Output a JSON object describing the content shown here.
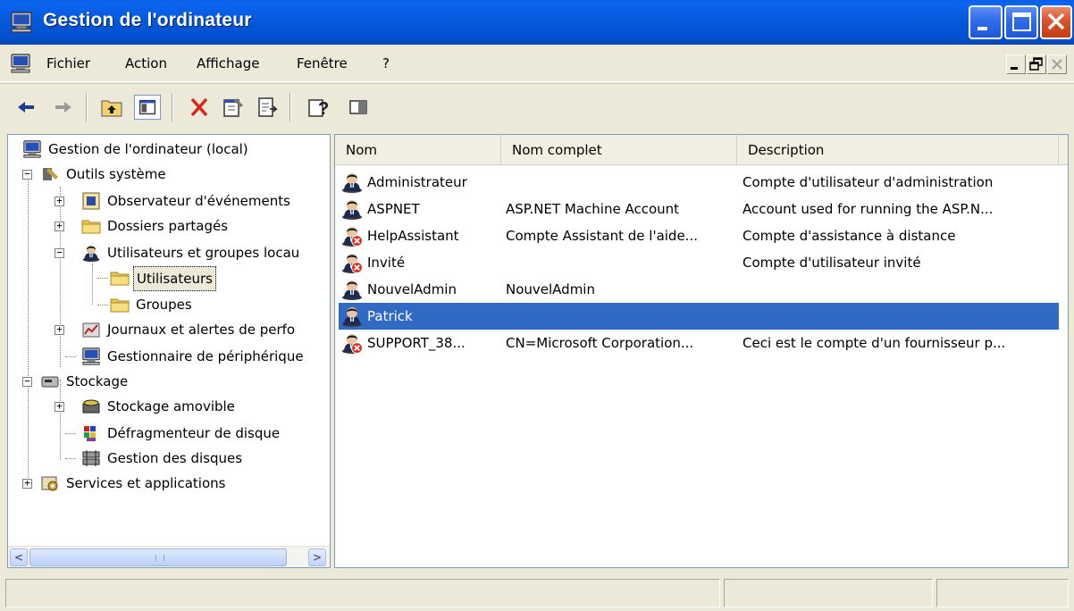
{
  "window": {
    "title": "Gestion de l'ordinateur",
    "title_icon": "computer-management-icon"
  },
  "menu": {
    "items": [
      "Fichier",
      "Action",
      "Affichage",
      "Fenêtre",
      "?"
    ]
  },
  "toolbar": {
    "buttons": [
      "back-icon",
      "forward-icon",
      "up-one-level-icon",
      "show-hide-tree-icon",
      "delete-icon",
      "properties-icon",
      "export-list-icon",
      "help-icon",
      "show-hide-action-pane-icon"
    ]
  },
  "tree": {
    "root": "Gestion de l'ordinateur (local)",
    "system_tools": "Outils système",
    "event_viewer": "Observateur d'événements",
    "shared_folders": "Dossiers partagés",
    "local_users": "Utilisateurs et groupes locau",
    "users": "Utilisateurs",
    "groups": "Groupes",
    "perf_logs": "Journaux et alertes de perfo",
    "device_manager": "Gestionnaire de périphérique",
    "storage": "Stockage",
    "removable_storage": "Stockage amovible",
    "defrag": "Défragmenteur de disque",
    "disk_mgmt": "Gestion des disques",
    "services_apps": "Services et applications"
  },
  "list": {
    "columns": [
      "Nom",
      "Nom complet",
      "Description"
    ],
    "rows": [
      {
        "name": "Administrateur",
        "full_name": "",
        "description": "Compte d'utilisateur d'administration",
        "disabled": false
      },
      {
        "name": "ASPNET",
        "full_name": "ASP.NET Machine Account",
        "description": "Account used for running the ASP.N...",
        "disabled": false
      },
      {
        "name": "HelpAssistant",
        "full_name": "Compte Assistant de l'aide...",
        "description": "Compte d'assistance à distance",
        "disabled": true
      },
      {
        "name": "Invité",
        "full_name": "",
        "description": "Compte d'utilisateur invité",
        "disabled": true
      },
      {
        "name": "NouvelAdmin",
        "full_name": "NouvelAdmin",
        "description": "",
        "disabled": false
      },
      {
        "name": "Patrick",
        "full_name": "",
        "description": "",
        "disabled": false,
        "selected": true
      },
      {
        "name": "SUPPORT_38...",
        "full_name": "CN=Microsoft Corporation...",
        "description": "Ceci est le compte d'un fournisseur p...",
        "disabled": true
      }
    ]
  },
  "colors": {
    "selection": "#316AC5",
    "titlebar": "#0458D9",
    "chrome": "#ECE9D8"
  }
}
